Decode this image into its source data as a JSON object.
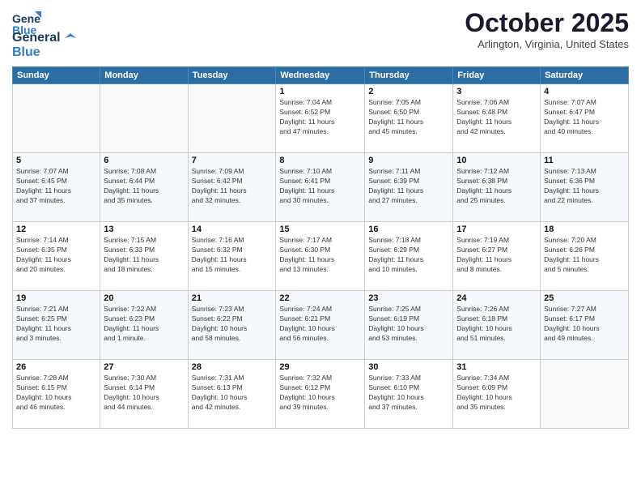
{
  "header": {
    "logo_line1": "General",
    "logo_line2": "Blue",
    "month": "October 2025",
    "location": "Arlington, Virginia, United States"
  },
  "weekdays": [
    "Sunday",
    "Monday",
    "Tuesday",
    "Wednesday",
    "Thursday",
    "Friday",
    "Saturday"
  ],
  "weeks": [
    [
      {
        "day": "",
        "info": ""
      },
      {
        "day": "",
        "info": ""
      },
      {
        "day": "",
        "info": ""
      },
      {
        "day": "1",
        "info": "Sunrise: 7:04 AM\nSunset: 6:52 PM\nDaylight: 11 hours\nand 47 minutes."
      },
      {
        "day": "2",
        "info": "Sunrise: 7:05 AM\nSunset: 6:50 PM\nDaylight: 11 hours\nand 45 minutes."
      },
      {
        "day": "3",
        "info": "Sunrise: 7:06 AM\nSunset: 6:48 PM\nDaylight: 11 hours\nand 42 minutes."
      },
      {
        "day": "4",
        "info": "Sunrise: 7:07 AM\nSunset: 6:47 PM\nDaylight: 11 hours\nand 40 minutes."
      }
    ],
    [
      {
        "day": "5",
        "info": "Sunrise: 7:07 AM\nSunset: 6:45 PM\nDaylight: 11 hours\nand 37 minutes."
      },
      {
        "day": "6",
        "info": "Sunrise: 7:08 AM\nSunset: 6:44 PM\nDaylight: 11 hours\nand 35 minutes."
      },
      {
        "day": "7",
        "info": "Sunrise: 7:09 AM\nSunset: 6:42 PM\nDaylight: 11 hours\nand 32 minutes."
      },
      {
        "day": "8",
        "info": "Sunrise: 7:10 AM\nSunset: 6:41 PM\nDaylight: 11 hours\nand 30 minutes."
      },
      {
        "day": "9",
        "info": "Sunrise: 7:11 AM\nSunset: 6:39 PM\nDaylight: 11 hours\nand 27 minutes."
      },
      {
        "day": "10",
        "info": "Sunrise: 7:12 AM\nSunset: 6:38 PM\nDaylight: 11 hours\nand 25 minutes."
      },
      {
        "day": "11",
        "info": "Sunrise: 7:13 AM\nSunset: 6:36 PM\nDaylight: 11 hours\nand 22 minutes."
      }
    ],
    [
      {
        "day": "12",
        "info": "Sunrise: 7:14 AM\nSunset: 6:35 PM\nDaylight: 11 hours\nand 20 minutes."
      },
      {
        "day": "13",
        "info": "Sunrise: 7:15 AM\nSunset: 6:33 PM\nDaylight: 11 hours\nand 18 minutes."
      },
      {
        "day": "14",
        "info": "Sunrise: 7:16 AM\nSunset: 6:32 PM\nDaylight: 11 hours\nand 15 minutes."
      },
      {
        "day": "15",
        "info": "Sunrise: 7:17 AM\nSunset: 6:30 PM\nDaylight: 11 hours\nand 13 minutes."
      },
      {
        "day": "16",
        "info": "Sunrise: 7:18 AM\nSunset: 6:29 PM\nDaylight: 11 hours\nand 10 minutes."
      },
      {
        "day": "17",
        "info": "Sunrise: 7:19 AM\nSunset: 6:27 PM\nDaylight: 11 hours\nand 8 minutes."
      },
      {
        "day": "18",
        "info": "Sunrise: 7:20 AM\nSunset: 6:26 PM\nDaylight: 11 hours\nand 5 minutes."
      }
    ],
    [
      {
        "day": "19",
        "info": "Sunrise: 7:21 AM\nSunset: 6:25 PM\nDaylight: 11 hours\nand 3 minutes."
      },
      {
        "day": "20",
        "info": "Sunrise: 7:22 AM\nSunset: 6:23 PM\nDaylight: 11 hours\nand 1 minute."
      },
      {
        "day": "21",
        "info": "Sunrise: 7:23 AM\nSunset: 6:22 PM\nDaylight: 10 hours\nand 58 minutes."
      },
      {
        "day": "22",
        "info": "Sunrise: 7:24 AM\nSunset: 6:21 PM\nDaylight: 10 hours\nand 56 minutes."
      },
      {
        "day": "23",
        "info": "Sunrise: 7:25 AM\nSunset: 6:19 PM\nDaylight: 10 hours\nand 53 minutes."
      },
      {
        "day": "24",
        "info": "Sunrise: 7:26 AM\nSunset: 6:18 PM\nDaylight: 10 hours\nand 51 minutes."
      },
      {
        "day": "25",
        "info": "Sunrise: 7:27 AM\nSunset: 6:17 PM\nDaylight: 10 hours\nand 49 minutes."
      }
    ],
    [
      {
        "day": "26",
        "info": "Sunrise: 7:28 AM\nSunset: 6:15 PM\nDaylight: 10 hours\nand 46 minutes."
      },
      {
        "day": "27",
        "info": "Sunrise: 7:30 AM\nSunset: 6:14 PM\nDaylight: 10 hours\nand 44 minutes."
      },
      {
        "day": "28",
        "info": "Sunrise: 7:31 AM\nSunset: 6:13 PM\nDaylight: 10 hours\nand 42 minutes."
      },
      {
        "day": "29",
        "info": "Sunrise: 7:32 AM\nSunset: 6:12 PM\nDaylight: 10 hours\nand 39 minutes."
      },
      {
        "day": "30",
        "info": "Sunrise: 7:33 AM\nSunset: 6:10 PM\nDaylight: 10 hours\nand 37 minutes."
      },
      {
        "day": "31",
        "info": "Sunrise: 7:34 AM\nSunset: 6:09 PM\nDaylight: 10 hours\nand 35 minutes."
      },
      {
        "day": "",
        "info": ""
      }
    ]
  ]
}
